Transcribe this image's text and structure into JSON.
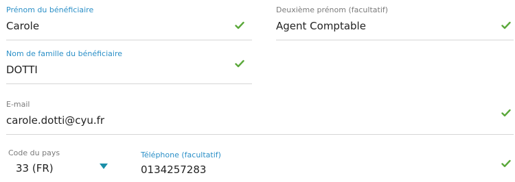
{
  "beneficiary": {
    "first_name": {
      "label": "Prénom du bénéficiaire",
      "value": "Carole"
    },
    "middle_name": {
      "label": "Deuxième prénom (facultatif)",
      "value": "Agent Comptable"
    },
    "last_name": {
      "label": "Nom de famille du bénéficiaire",
      "value": "DOTTI"
    },
    "email": {
      "label": "E-mail",
      "value": "carole.dotti@cyu.fr"
    },
    "country_code": {
      "label": "Code du pays",
      "value": "33 (FR)"
    },
    "phone": {
      "label": "Téléphone (facultatif)",
      "value": "0134257283"
    }
  },
  "colors": {
    "label_blue": "#2a8fc7",
    "check_green": "#5aa83a",
    "arrow_teal": "#1a8fa8",
    "underline": "#d6d6d6"
  },
  "icons": {
    "valid": "check-icon",
    "dropdown": "caret-down-icon"
  }
}
